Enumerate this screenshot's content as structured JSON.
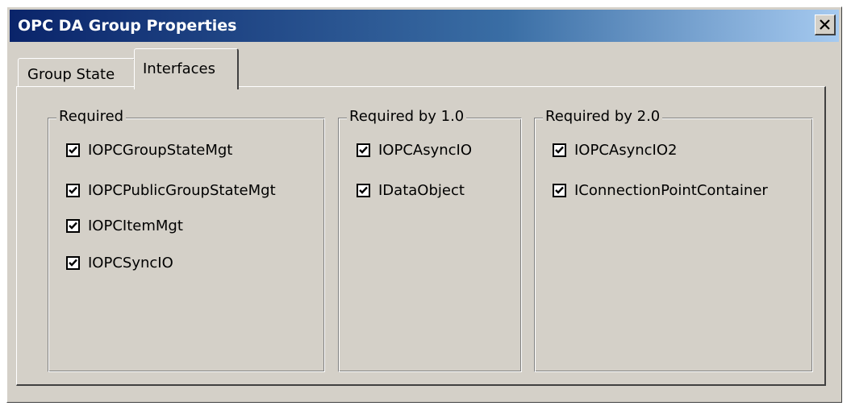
{
  "window": {
    "title": "OPC DA Group Properties",
    "close_symbol": "close-icon"
  },
  "tabs": [
    {
      "label": "Group State",
      "active": false
    },
    {
      "label": "Interfaces",
      "active": true
    }
  ],
  "groups": [
    {
      "legend": "Required",
      "items": [
        {
          "label": "IOPCGroupStateMgt",
          "checked": true
        },
        {
          "label": "IOPCPublicGroupStateMgt",
          "checked": true
        },
        {
          "label": "IOPCItemMgt",
          "checked": true
        },
        {
          "label": "IOPCSyncIO",
          "checked": true
        }
      ]
    },
    {
      "legend": "Required by 1.0",
      "items": [
        {
          "label": "IOPCAsyncIO",
          "checked": true
        },
        {
          "label": "IDataObject",
          "checked": true
        }
      ]
    },
    {
      "legend": "Required by 2.0",
      "items": [
        {
          "label": "IOPCAsyncIO2",
          "checked": true
        },
        {
          "label": "IConnectionPointContainer",
          "checked": true
        }
      ]
    }
  ],
  "colors": {
    "titlebar_start": "#0a246a",
    "titlebar_end": "#a6caf0",
    "face": "#d4d0c8"
  }
}
